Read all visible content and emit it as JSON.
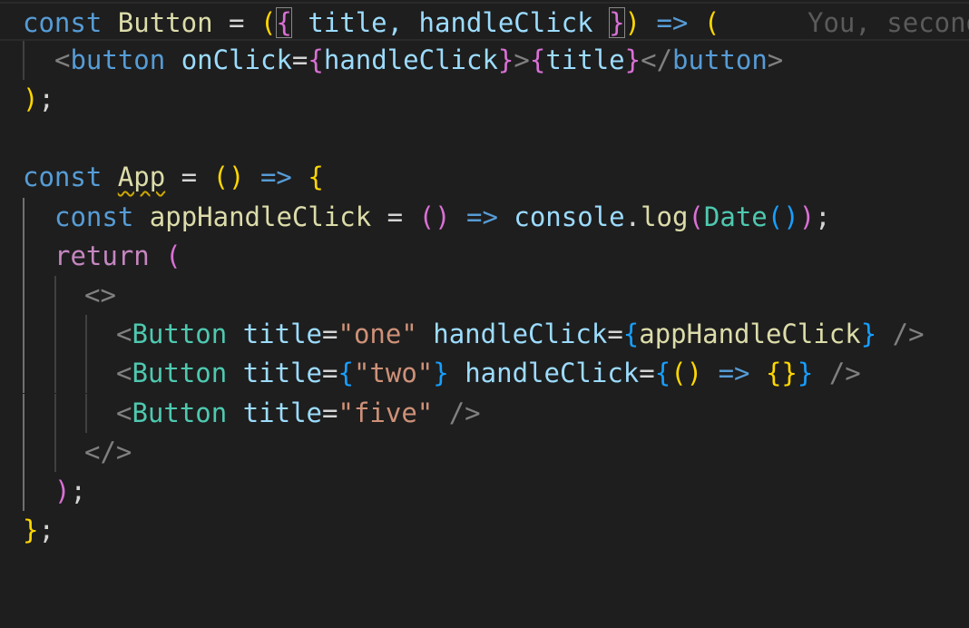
{
  "blame": "You, second",
  "lines": [
    {
      "tokens": [
        {
          "t": "const",
          "c": "kw"
        },
        {
          "t": " ",
          "c": "op"
        },
        {
          "t": "Button",
          "c": "fn"
        },
        {
          "t": " = ",
          "c": "op"
        },
        {
          "t": "(",
          "c": "b1"
        },
        {
          "t": "{",
          "c": "b2",
          "box": true
        },
        {
          "t": " title, handleClick ",
          "c": "var"
        },
        {
          "t": "}",
          "c": "b2",
          "box": true
        },
        {
          "t": ")",
          "c": "b1"
        },
        {
          "t": " => ",
          "c": "kw"
        },
        {
          "t": "(",
          "c": "b1"
        }
      ]
    },
    {
      "tokens": [
        {
          "t": "<",
          "c": "punc"
        },
        {
          "t": "button",
          "c": "tag"
        },
        {
          "t": " ",
          "c": "op"
        },
        {
          "t": "onClick",
          "c": "var"
        },
        {
          "t": "=",
          "c": "op"
        },
        {
          "t": "{",
          "c": "b2"
        },
        {
          "t": "handleClick",
          "c": "var"
        },
        {
          "t": "}",
          "c": "b2"
        },
        {
          "t": ">",
          "c": "punc"
        },
        {
          "t": "{",
          "c": "b2"
        },
        {
          "t": "title",
          "c": "var"
        },
        {
          "t": "}",
          "c": "b2"
        },
        {
          "t": "</",
          "c": "punc"
        },
        {
          "t": "button",
          "c": "tag"
        },
        {
          "t": ">",
          "c": "punc"
        }
      ]
    },
    {
      "tokens": [
        {
          "t": ")",
          "c": "b1"
        },
        {
          "t": ";",
          "c": "op"
        }
      ]
    },
    {
      "tokens": []
    },
    {
      "tokens": [
        {
          "t": "const",
          "c": "kw"
        },
        {
          "t": " ",
          "c": "op"
        },
        {
          "t": "App",
          "c": "fn",
          "squig": true
        },
        {
          "t": " = ",
          "c": "op"
        },
        {
          "t": "()",
          "c": "b1"
        },
        {
          "t": " => ",
          "c": "kw"
        },
        {
          "t": "{",
          "c": "b1"
        }
      ]
    },
    {
      "tokens": [
        {
          "t": "const",
          "c": "kw"
        },
        {
          "t": " ",
          "c": "op"
        },
        {
          "t": "appHandleClick",
          "c": "fn"
        },
        {
          "t": " = ",
          "c": "op"
        },
        {
          "t": "()",
          "c": "b2"
        },
        {
          "t": " => ",
          "c": "kw"
        },
        {
          "t": "console",
          "c": "var"
        },
        {
          "t": ".",
          "c": "op"
        },
        {
          "t": "log",
          "c": "fn"
        },
        {
          "t": "(",
          "c": "b2"
        },
        {
          "t": "Date",
          "c": "cmp"
        },
        {
          "t": "()",
          "c": "b3"
        },
        {
          "t": ")",
          "c": "b2"
        },
        {
          "t": ";",
          "c": "op"
        }
      ]
    },
    {
      "tokens": [
        {
          "t": "return",
          "c": "ctl"
        },
        {
          "t": " ",
          "c": "op"
        },
        {
          "t": "(",
          "c": "b2"
        }
      ]
    },
    {
      "tokens": [
        {
          "t": "<>",
          "c": "punc"
        }
      ]
    },
    {
      "tokens": [
        {
          "t": "<",
          "c": "punc"
        },
        {
          "t": "Button",
          "c": "cmp"
        },
        {
          "t": " ",
          "c": "op"
        },
        {
          "t": "title",
          "c": "var"
        },
        {
          "t": "=",
          "c": "op"
        },
        {
          "t": "\"one\"",
          "c": "str"
        },
        {
          "t": " ",
          "c": "op"
        },
        {
          "t": "handleClick",
          "c": "var"
        },
        {
          "t": "=",
          "c": "op"
        },
        {
          "t": "{",
          "c": "b3"
        },
        {
          "t": "appHandleClick",
          "c": "fn"
        },
        {
          "t": "}",
          "c": "b3"
        },
        {
          "t": " />",
          "c": "punc"
        }
      ]
    },
    {
      "tokens": [
        {
          "t": "<",
          "c": "punc"
        },
        {
          "t": "Button",
          "c": "cmp"
        },
        {
          "t": " ",
          "c": "op"
        },
        {
          "t": "title",
          "c": "var"
        },
        {
          "t": "=",
          "c": "op"
        },
        {
          "t": "{",
          "c": "b3"
        },
        {
          "t": "\"two\"",
          "c": "str"
        },
        {
          "t": "}",
          "c": "b3"
        },
        {
          "t": " ",
          "c": "op"
        },
        {
          "t": "handleClick",
          "c": "var"
        },
        {
          "t": "=",
          "c": "op"
        },
        {
          "t": "{",
          "c": "b3"
        },
        {
          "t": "()",
          "c": "b1"
        },
        {
          "t": " => ",
          "c": "kw"
        },
        {
          "t": "{}",
          "c": "b1"
        },
        {
          "t": "}",
          "c": "b3"
        },
        {
          "t": " />",
          "c": "punc"
        }
      ]
    },
    {
      "tokens": [
        {
          "t": "<",
          "c": "punc"
        },
        {
          "t": "Button",
          "c": "cmp"
        },
        {
          "t": " ",
          "c": "op"
        },
        {
          "t": "title",
          "c": "var"
        },
        {
          "t": "=",
          "c": "op"
        },
        {
          "t": "\"five\"",
          "c": "str"
        },
        {
          "t": " />",
          "c": "punc"
        }
      ]
    },
    {
      "tokens": [
        {
          "t": "</>",
          "c": "punc"
        }
      ]
    },
    {
      "tokens": [
        {
          "t": ")",
          "c": "b2"
        },
        {
          "t": ";",
          "c": "op"
        }
      ]
    },
    {
      "tokens": [
        {
          "t": "}",
          "c": "b1"
        },
        {
          "t": ";",
          "c": "op"
        }
      ]
    }
  ]
}
